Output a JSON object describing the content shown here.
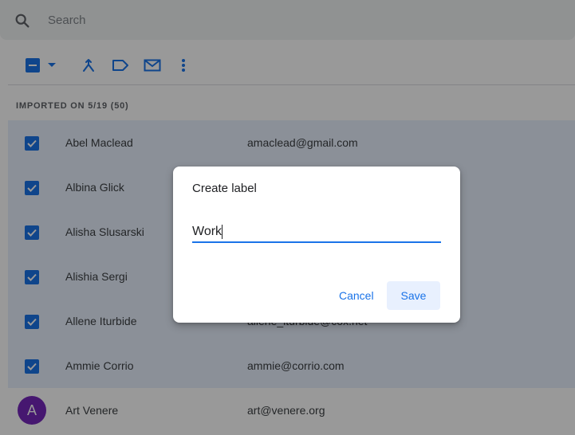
{
  "search": {
    "placeholder": "Search"
  },
  "toolbar": {
    "select_all_icon": "minus-checkbox-icon",
    "dropdown_icon": "caret-down-icon",
    "merge_icon": "merge-icon",
    "label_icon": "label-icon",
    "email_icon": "mail-icon",
    "more_icon": "more-vert-icon"
  },
  "section": {
    "header": "IMPORTED ON 5/19 (50)"
  },
  "contacts": [
    {
      "name": "Abel Maclead",
      "email": "amaclead@gmail.com",
      "selected": true
    },
    {
      "name": "Albina Glick",
      "email": "",
      "selected": true
    },
    {
      "name": "Alisha Slusarski",
      "email": "",
      "selected": true
    },
    {
      "name": "Alishia Sergi",
      "email": "",
      "selected": true
    },
    {
      "name": "Allene Iturbide",
      "email": "allene_iturbide@cox.net",
      "selected": true
    },
    {
      "name": "Ammie Corrio",
      "email": "ammie@corrio.com",
      "selected": true
    },
    {
      "name": "Art Venere",
      "email": "art@venere.org",
      "selected": false,
      "avatar": "A"
    }
  ],
  "dialog": {
    "title": "Create label",
    "input_value": "Work",
    "cancel_label": "Cancel",
    "save_label": "Save"
  },
  "colors": {
    "accent": "#1a73e8",
    "avatar": "#7627bb"
  }
}
